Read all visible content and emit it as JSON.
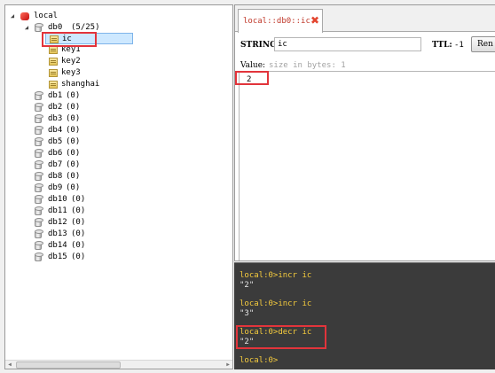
{
  "tree": {
    "server": "local",
    "db0": {
      "name": "db0",
      "count": "(5/25)"
    },
    "keys": [
      "ic",
      "key1",
      "key2",
      "key3",
      "shanghai"
    ],
    "databases": [
      {
        "name": "db1",
        "count": "(0)"
      },
      {
        "name": "db2",
        "count": "(0)"
      },
      {
        "name": "db3",
        "count": "(0)"
      },
      {
        "name": "db4",
        "count": "(0)"
      },
      {
        "name": "db5",
        "count": "(0)"
      },
      {
        "name": "db6",
        "count": "(0)"
      },
      {
        "name": "db7",
        "count": "(0)"
      },
      {
        "name": "db8",
        "count": "(0)"
      },
      {
        "name": "db9",
        "count": "(0)"
      },
      {
        "name": "db10",
        "count": "(0)"
      },
      {
        "name": "db11",
        "count": "(0)"
      },
      {
        "name": "db12",
        "count": "(0)"
      },
      {
        "name": "db13",
        "count": "(0)"
      },
      {
        "name": "db14",
        "count": "(0)"
      },
      {
        "name": "db15",
        "count": "(0)"
      }
    ]
  },
  "tab": {
    "title": "local::db0::ic",
    "close_glyph": "✖"
  },
  "editor": {
    "type_label": "STRING:",
    "key_name": "ic",
    "ttl_label": "TTL:",
    "ttl_value": "-1",
    "rename_label": "Ren",
    "value_label": "Value:",
    "value_hint": "size in bytes: 1",
    "value": "2"
  },
  "console": {
    "lines": [
      {
        "text": "local:0>incr ic",
        "kind": "cmd"
      },
      {
        "text": "\"2\"",
        "kind": "out"
      },
      {
        "text": "",
        "kind": "out"
      },
      {
        "text": "local:0>incr ic",
        "kind": "cmd"
      },
      {
        "text": "\"3\"",
        "kind": "out"
      },
      {
        "text": "",
        "kind": "out"
      },
      {
        "text": "local:0>decr ic",
        "kind": "cmd"
      },
      {
        "text": "\"2\"",
        "kind": "out"
      },
      {
        "text": "",
        "kind": "out"
      },
      {
        "text": "local:0>",
        "kind": "cmd"
      }
    ]
  },
  "colors": {
    "highlight": "#e2343b",
    "console_bg": "#3b3b3b",
    "console_cmd": "#f6cc3d",
    "console_out": "#e6e6e6",
    "tab_title": "#c0392b"
  },
  "icons": {
    "server": "redis-server-icon",
    "database": "database-icon",
    "key": "string-key-icon",
    "close": "close-tab-icon"
  }
}
